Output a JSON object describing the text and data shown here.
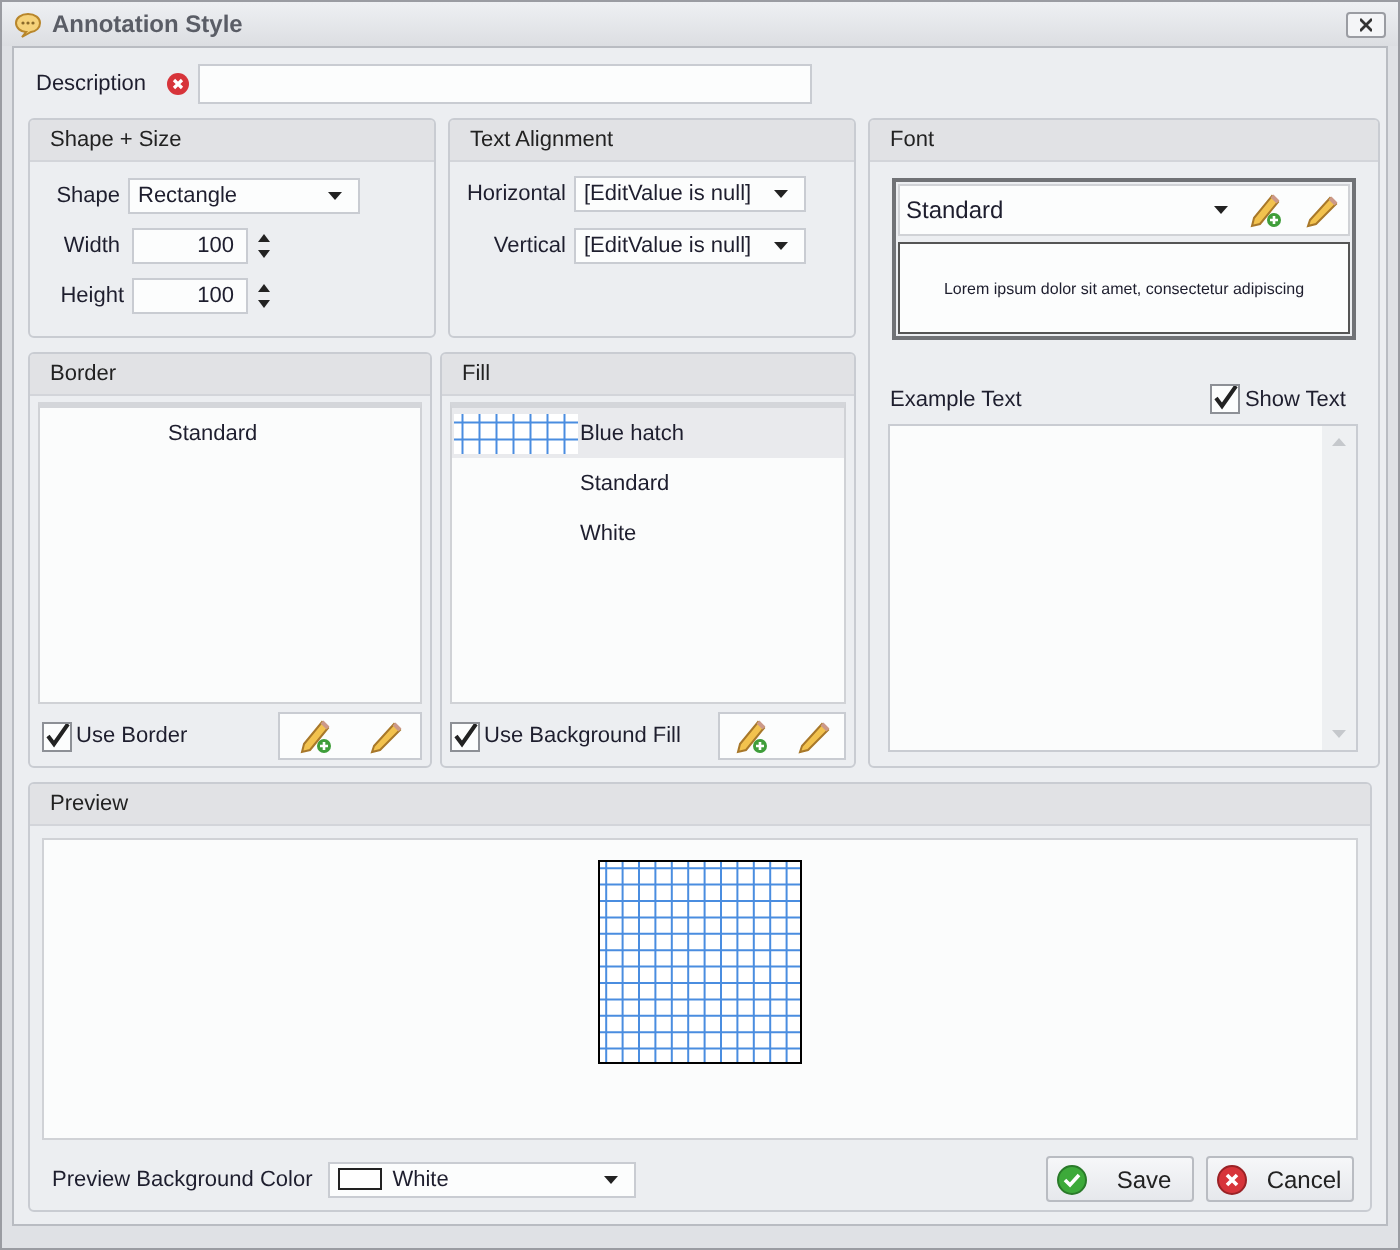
{
  "window": {
    "title": "Annotation Style"
  },
  "description": {
    "label": "Description",
    "invalid": true
  },
  "shape_size": {
    "title": "Shape + Size",
    "shape": {
      "label": "Shape",
      "value": "Rectangle"
    },
    "width": {
      "label": "Width",
      "value": "100"
    },
    "height": {
      "label": "Height",
      "value": "100"
    }
  },
  "text_alignment": {
    "title": "Text Alignment",
    "horizontal": {
      "label": "Horizontal",
      "value": "[EditValue is null]"
    },
    "vertical": {
      "label": "Vertical",
      "value": "[EditValue is null]"
    }
  },
  "font": {
    "title": "Font",
    "selector": {
      "value": "Standard"
    },
    "sample": "Lorem ipsum dolor sit amet, consectetur adipiscing",
    "example_text": {
      "label": "Example Text"
    },
    "show_text": {
      "label": "Show Text",
      "checked": true
    }
  },
  "border": {
    "title": "Border",
    "items": [
      {
        "label": "Standard",
        "selected": false
      }
    ],
    "use": {
      "label": "Use Border",
      "checked": true
    }
  },
  "fill": {
    "title": "Fill",
    "items": [
      {
        "label": "Blue hatch",
        "selected": true,
        "kind": "hatch"
      },
      {
        "label": "Standard",
        "selected": false,
        "kind": "plain"
      },
      {
        "label": "White",
        "selected": false,
        "kind": "plain"
      }
    ],
    "use": {
      "label": "Use Background Fill",
      "checked": true
    }
  },
  "preview": {
    "title": "Preview",
    "background": {
      "label": "Preview Background Color",
      "value": "White"
    }
  },
  "buttons": [
    {
      "label": "Save",
      "kind": "save"
    },
    {
      "label": "Cancel",
      "kind": "cancel"
    }
  ]
}
